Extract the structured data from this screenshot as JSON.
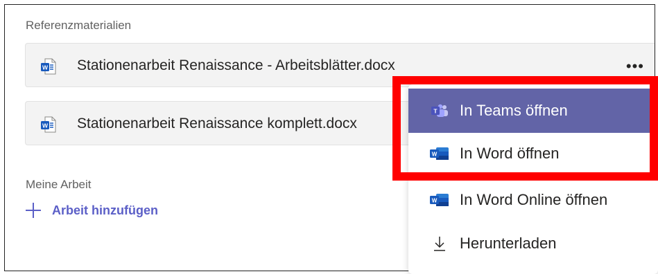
{
  "reference_section": {
    "label": "Referenzmaterialien"
  },
  "files": [
    {
      "name": "Stationenarbeit Renaissance - Arbeitsblätter.docx",
      "icon": "word-doc-icon"
    },
    {
      "name": "Stationenarbeit Renaissance komplett.docx",
      "icon": "word-doc-icon"
    }
  ],
  "more_options": {
    "label": "•••"
  },
  "my_work": {
    "label": "Meine Arbeit",
    "add_label": "Arbeit hinzufügen"
  },
  "context_menu": {
    "items": [
      {
        "label": "In Teams öffnen",
        "icon": "teams-icon",
        "selected": true
      },
      {
        "label": "In Word öffnen",
        "icon": "word-icon"
      },
      {
        "label": "In Word Online öffnen",
        "icon": "word-icon"
      },
      {
        "label": "Herunterladen",
        "icon": "download-icon"
      }
    ]
  },
  "colors": {
    "accent": "#5b5fc7",
    "menu_selected": "#6264a7",
    "highlight": "#ff0000",
    "word_blue": "#185abd"
  }
}
